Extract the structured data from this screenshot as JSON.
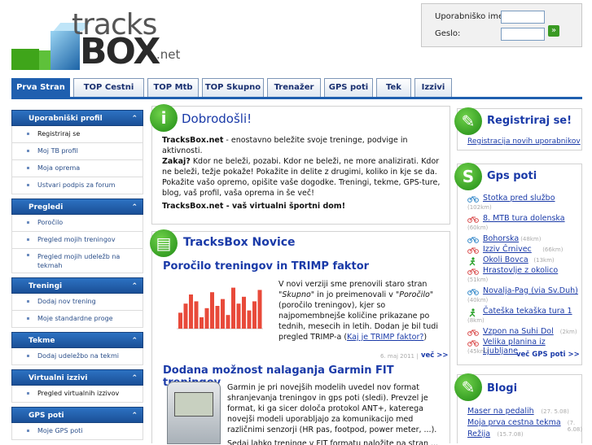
{
  "logo": {
    "word1": "tracks",
    "word2": "BOX",
    "domain": ".net"
  },
  "login": {
    "username_label": "Uporabniško ime:",
    "password_label": "Geslo:",
    "submit_symbol": "»"
  },
  "tabs": [
    "Prva Stran",
    "TOP Cestni",
    "TOP Mtb",
    "TOP Skupno",
    "Trenažer",
    "GPS poti",
    "Tek",
    "Izzivi"
  ],
  "sidebar": {
    "profile": {
      "title": "Uporabniški profil",
      "items": [
        "Registriraj se",
        "Moj TB profil",
        "Moja oprema",
        "Ustvari podpis za forum"
      ]
    },
    "overview": {
      "title": "Pregledi",
      "items": [
        "Poročilo",
        "Pregled mojih treningov",
        "Pregled mojih udeležb na tekmah"
      ]
    },
    "trainings": {
      "title": "Treningi",
      "items": [
        "Dodaj nov trening",
        "Moje standardne proge"
      ]
    },
    "races": {
      "title": "Tekme",
      "items": [
        "Dodaj udeležbo na tekmi"
      ]
    },
    "challenges": {
      "title": "Virtualni izzivi",
      "items": [
        "Pregled virtualnih izzivov"
      ]
    },
    "gps": {
      "title": "GPS poti",
      "items": [
        "Moje GPS poti"
      ]
    }
  },
  "welcome": {
    "title": "Dobrodošli!",
    "brand": "TracksBox.net",
    "line1": " - enostavno beležite svoje treninge, podvige in aktivnosti.",
    "line2_bold": "Zakaj?",
    "line2": " Kdor ne beleži, pozabi. Kdor ne beleži, ne more analizirati. Kdor ne beleži, težje pokaže! Pokažite in delite z drugimi, koliko in kje se da. Pokažite vašo opremo, opišite vaše dogodke. Treningi, tekme, GPS-ture, blog, vaš profil, vaša oprema in še več!",
    "tagline": "TracksBox.net - vaš virtualni športni dom!"
  },
  "news": {
    "title": "TracksBox Novice",
    "item1": {
      "title": "Poročilo treningov in TRIMP faktor",
      "text_a": "V novi verziji sme prenovili staro stran ",
      "text_italic1": "\"Skupno\"",
      "text_b": " in jo preimenovali v ",
      "text_italic2": "\"Poročilo\"",
      "text_c": " (poročilo treningov), kjer so najpomembnejše količine prikazane po tednih, mesecih in letih. Dodan je bil tudi pregled TRIMP-a (",
      "link": "Kaj je TRIMP faktor?",
      "text_d": ")",
      "date": "6. maj 2011 |",
      "more": "več >>",
      "chart_bars": [
        0.35,
        0.55,
        0.75,
        0.6,
        0.25,
        0.45,
        0.8,
        0.5,
        0.65,
        0.3,
        0.9,
        0.55,
        0.7,
        0.4,
        0.6,
        0.85
      ]
    },
    "item2": {
      "title": "Dodana možnost nalaganja Garmin FIT treningov",
      "text": "Garmin je pri novejših modelih uvedel nov format shranjevanja treningov in gps poti (sledi). Prevzel je format, ki ga sicer določa protokol ANT+, katerega novejši modeli uporabljajo za komunikacijo med različnimi senzorji (HR pas, footpod, power meter, ...).",
      "text_next": "Sedaj lahko treninge v FIT formatu naložite na stran ..."
    }
  },
  "register": {
    "title": "Registriraj se!",
    "link": "Registracija novih uporabnikov"
  },
  "gps_routes": {
    "title": "Gps poti",
    "items": [
      {
        "name": "Stotka pred službo",
        "km": "(102km)",
        "type": "bike-blue"
      },
      {
        "name": "8. MTB tura dolenska",
        "km": "(60km)",
        "type": "bike-red"
      },
      {
        "name": "Bohorska",
        "km": "(48km)",
        "type": "bike-blue"
      },
      {
        "name": "Izziv Črnivec",
        "km": "(66km)",
        "type": "bike-red"
      },
      {
        "name": "Okoli Bovca",
        "km": "(13km)",
        "type": "run"
      },
      {
        "name": "Hrastovlje z okolico",
        "km": "(51km)",
        "type": "bike-red"
      },
      {
        "name": "Novalja-Pag (via Sv.Duh)",
        "km": "(40km)",
        "type": "bike-blue"
      },
      {
        "name": "Čateška tekaška tura 1",
        "km": "(8km)",
        "type": "run"
      },
      {
        "name": "Vzpon na Suhi Dol",
        "km": "(2km)",
        "type": "bike-red"
      },
      {
        "name": "Velika planina iz Ljubljane",
        "km": "(45km)",
        "type": "bike-red"
      }
    ],
    "more": "več GPS poti >>"
  },
  "blogs": {
    "title": "Blogi",
    "items": [
      {
        "name": "Maser na pedalih",
        "date": "(27. 5.08)"
      },
      {
        "name": "Moja prva cestna tekma",
        "date": "(7. 6.08)"
      },
      {
        "name": "Režija",
        "date": "(15.7.08)"
      }
    ]
  },
  "colors": {
    "brand_blue": "#1f5faf",
    "green": "#3fa51a",
    "link": "#1a3aa8"
  }
}
